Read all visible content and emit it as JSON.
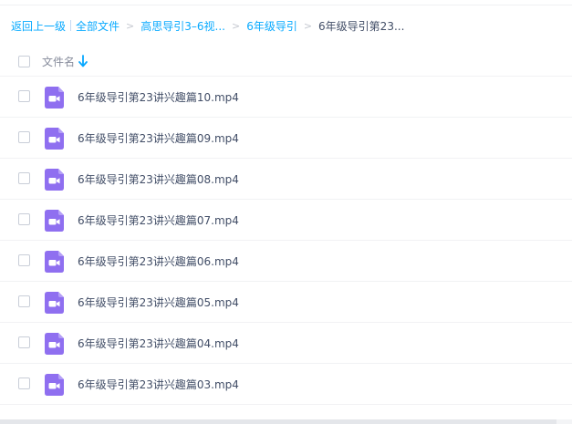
{
  "breadcrumb": {
    "back_label": "返回上一级",
    "items": [
      {
        "label": "全部文件"
      },
      {
        "label": "高思导引3–6视..."
      },
      {
        "label": "6年级导引"
      }
    ],
    "current": "6年级导引第23..."
  },
  "list_header": {
    "name_column": "文件名",
    "sort_icon": "arrow-down-icon",
    "sort_direction": "descending"
  },
  "files": [
    {
      "name": "6年级导引第23讲兴趣篇10.mp4",
      "icon": "video-file-icon"
    },
    {
      "name": "6年级导引第23讲兴趣篇09.mp4",
      "icon": "video-file-icon"
    },
    {
      "name": "6年级导引第23讲兴趣篇08.mp4",
      "icon": "video-file-icon"
    },
    {
      "name": "6年级导引第23讲兴趣篇07.mp4",
      "icon": "video-file-icon"
    },
    {
      "name": "6年级导引第23讲兴趣篇06.mp4",
      "icon": "video-file-icon"
    },
    {
      "name": "6年级导引第23讲兴趣篇05.mp4",
      "icon": "video-file-icon"
    },
    {
      "name": "6年级导引第23讲兴趣篇04.mp4",
      "icon": "video-file-icon"
    },
    {
      "name": "6年级导引第23讲兴趣篇03.mp4",
      "icon": "video-file-icon"
    }
  ],
  "colors": {
    "link": "#09aaff",
    "text": "#424e67",
    "muted": "#878c9c",
    "video_icon": "#8f6ff0",
    "sort_arrow": "#06a7ff",
    "row_divider": "#f1f2f4"
  }
}
